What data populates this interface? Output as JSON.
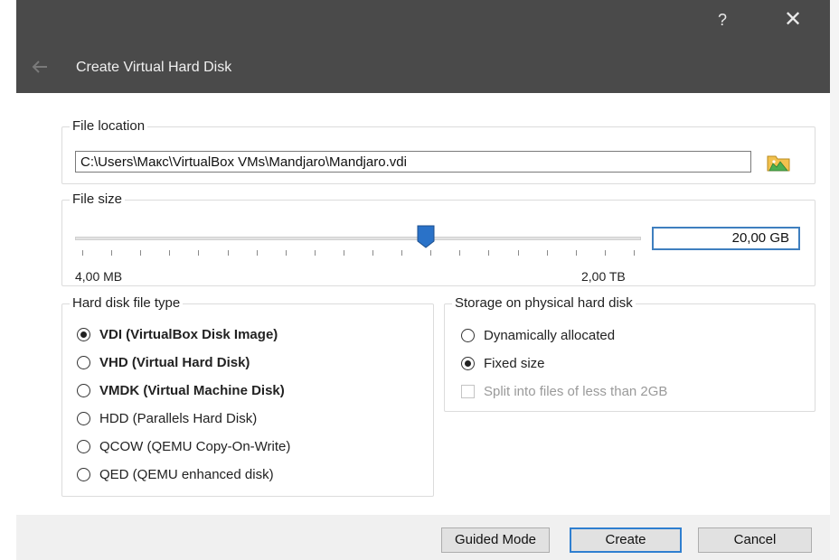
{
  "window": {
    "help_label": "?",
    "close_label": "✕",
    "title": "Create Virtual Hard Disk",
    "back_icon": "arrow-left-icon"
  },
  "file_location": {
    "title": "File location",
    "path": "C:\\Users\\Макс\\VirtualBox VMs\\Mandjaro\\Mandjaro.vdi",
    "browse_icon": "folder-icon"
  },
  "file_size": {
    "title": "File size",
    "value": "20,00 GB",
    "min_label": "4,00 MB",
    "max_label": "2,00 TB",
    "slider_fraction": 0.62
  },
  "disk_type": {
    "title": "Hard disk file type",
    "options": [
      {
        "label": "VDI (VirtualBox Disk Image)",
        "checked": true,
        "bold": true
      },
      {
        "label": "VHD (Virtual Hard Disk)",
        "checked": false,
        "bold": true
      },
      {
        "label": "VMDK (Virtual Machine Disk)",
        "checked": false,
        "bold": true
      },
      {
        "label": "HDD (Parallels Hard Disk)",
        "checked": false,
        "bold": false
      },
      {
        "label": "QCOW (QEMU Copy-On-Write)",
        "checked": false,
        "bold": false
      },
      {
        "label": "QED (QEMU enhanced disk)",
        "checked": false,
        "bold": false
      }
    ]
  },
  "storage": {
    "title": "Storage on physical hard disk",
    "options": [
      {
        "label": "Dynamically allocated",
        "checked": false
      },
      {
        "label": "Fixed size",
        "checked": true
      }
    ],
    "split_label": "Split into files of less than 2GB",
    "split_checked": false,
    "split_enabled": false
  },
  "buttons": {
    "guided": "Guided Mode",
    "create": "Create",
    "cancel": "Cancel"
  },
  "colors": {
    "header_bg": "#4a4a4a",
    "accent": "#2f7fd0",
    "slider_handle": "#2a72c8"
  }
}
